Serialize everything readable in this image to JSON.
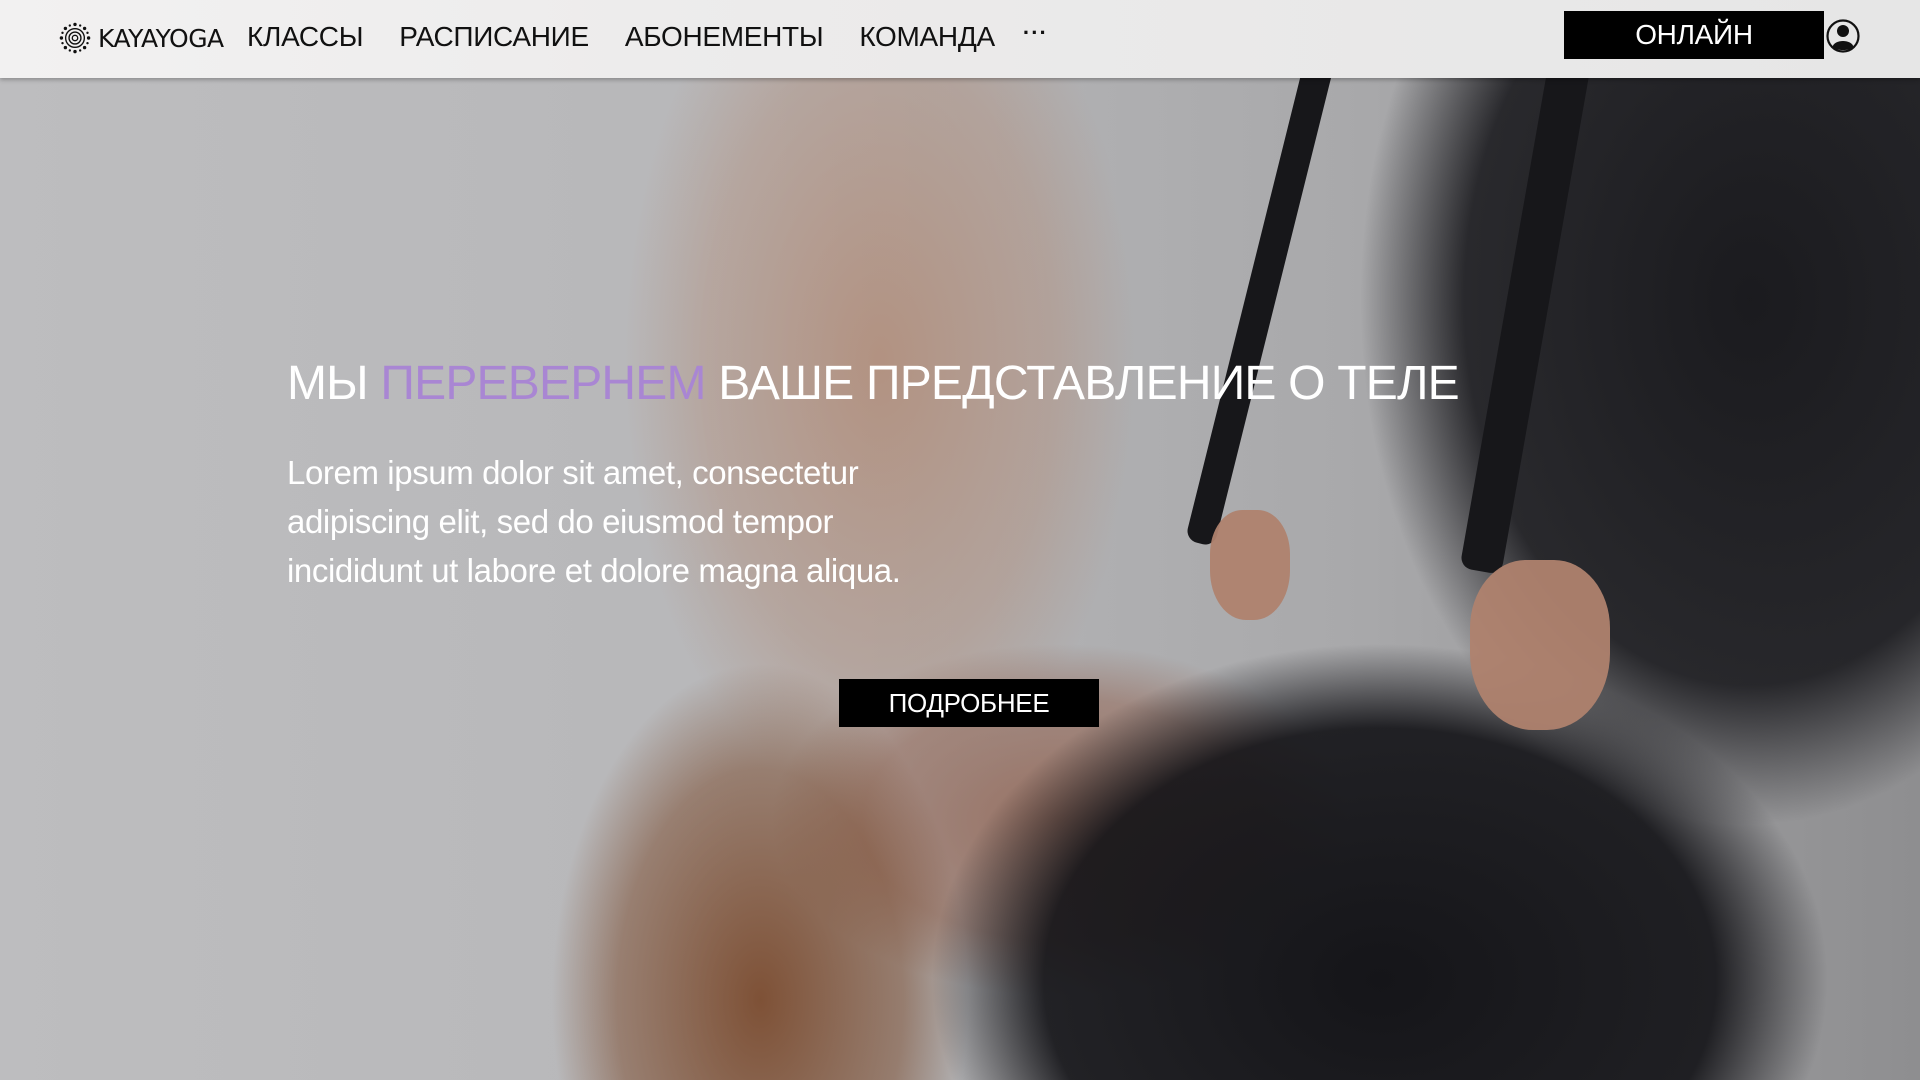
{
  "brand": {
    "name": "KAYAYOGA",
    "logo_icon": "sun-mandala-icon"
  },
  "nav": {
    "items": [
      {
        "label": "КЛАССЫ"
      },
      {
        "label": "РАСПИСАНИЕ"
      },
      {
        "label": "АБОНЕМЕНТЫ"
      },
      {
        "label": "КОМАНДА"
      }
    ],
    "more_label": "···"
  },
  "header": {
    "online_label": "ОНЛАЙН",
    "account_icon": "user-account-icon"
  },
  "hero": {
    "title_prefix": "МЫ ",
    "title_accent": "ПЕРЕВЕРНЕМ",
    "title_suffix": " ВАШЕ ПРЕДСТАВЛЕНИЕ О ТЕЛЕ",
    "text": "Lorem ipsum dolor sit amet, consectetur adipiscing elit, sed do eiusmod tempor incididunt ut labore et dolore magna aliqua.",
    "button_label": "ПОДРОБНЕЕ",
    "background_image": "aerial-yoga-photo"
  },
  "colors": {
    "accent": "#a986d3",
    "button_bg": "#000000",
    "button_text": "#ffffff",
    "header_bg": "#ecebeb"
  }
}
